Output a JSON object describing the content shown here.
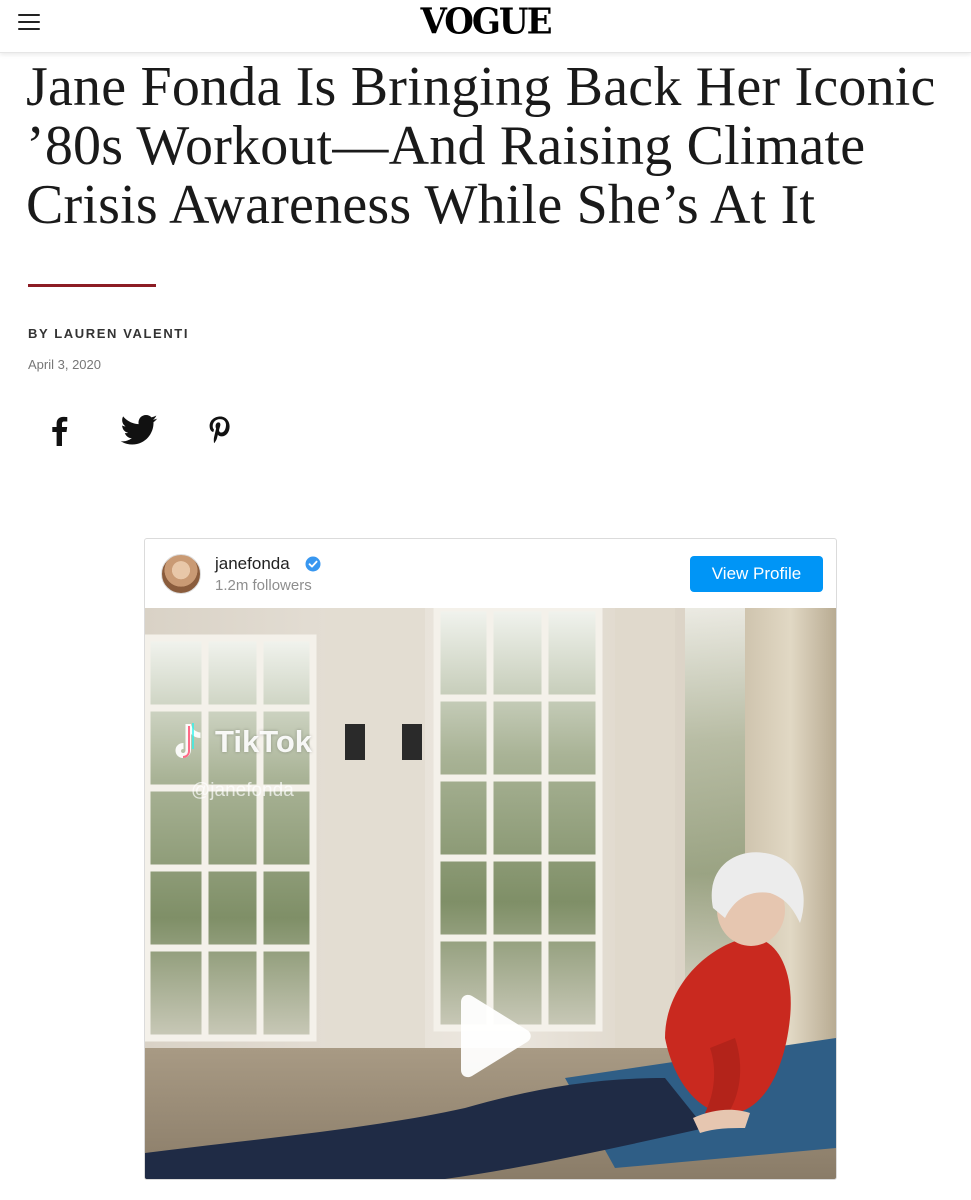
{
  "header": {
    "logo": "VOGUE",
    "menu_icon": "hamburger-menu-icon"
  },
  "article": {
    "headline_lines": [
      "Jane Fonda Is Bringing Back Her Iconic",
      "’80s Workout—And Raising Climate",
      "Crisis Awareness While She’s At It"
    ],
    "byline": "BY LAUREN VALENTI",
    "date": "April 3, 2020",
    "accent_color": "#8c1c24"
  },
  "share": {
    "icons": [
      "facebook-icon",
      "twitter-icon",
      "pinterest-icon"
    ]
  },
  "instagram_embed": {
    "username": "janefonda",
    "followers": "1.2m followers",
    "view_profile_label": "View Profile",
    "button_color": "#0095f6",
    "video": {
      "watermark_brand": "TikTok",
      "watermark_handle": "@janefonda",
      "play_icon": "play-icon"
    }
  }
}
